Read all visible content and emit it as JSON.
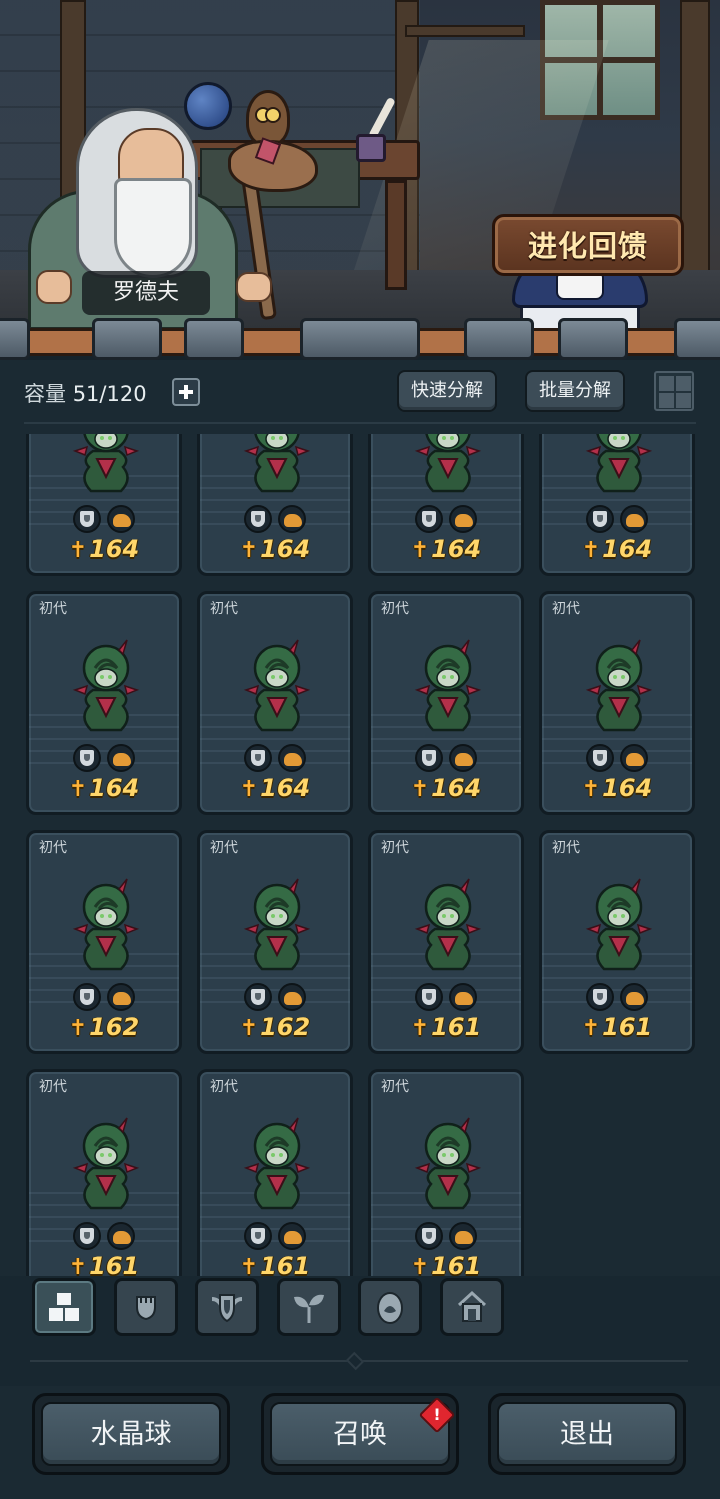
{
  "scene": {
    "npc_name": "罗德夫",
    "evolve_feedback_label": "进化回馈"
  },
  "inventory": {
    "capacity_label": "容量",
    "capacity_value": "51/120",
    "quick_decompose_label": "快速分解",
    "batch_decompose_label": "批量分解"
  },
  "cards": [
    {
      "generation": "",
      "power": "164"
    },
    {
      "generation": "",
      "power": "164"
    },
    {
      "generation": "",
      "power": "164"
    },
    {
      "generation": "",
      "power": "164"
    },
    {
      "generation": "初代",
      "power": "164"
    },
    {
      "generation": "初代",
      "power": "164"
    },
    {
      "generation": "初代",
      "power": "164"
    },
    {
      "generation": "初代",
      "power": "164"
    },
    {
      "generation": "初代",
      "power": "162"
    },
    {
      "generation": "初代",
      "power": "162"
    },
    {
      "generation": "初代",
      "power": "161"
    },
    {
      "generation": "初代",
      "power": "161"
    },
    {
      "generation": "初代",
      "power": "161"
    },
    {
      "generation": "初代",
      "power": "161"
    },
    {
      "generation": "初代",
      "power": "161"
    }
  ],
  "category_tabs": [
    {
      "icon": "all-items-icon",
      "active": true
    },
    {
      "icon": "fist-icon",
      "active": false
    },
    {
      "icon": "winged-shield-icon",
      "active": false
    },
    {
      "icon": "sprout-icon",
      "active": false
    },
    {
      "icon": "egg-icon",
      "active": false
    },
    {
      "icon": "house-icon",
      "active": false
    }
  ],
  "bottom": {
    "crystal_ball_label": "水晶球",
    "summon_label": "召唤",
    "summon_alert": "!",
    "exit_label": "退出"
  },
  "colors": {
    "power_text": "#ffd66a",
    "alert": "#e0262f",
    "card_bg": "#2c3e4b",
    "panel_bg": "#1b2a33"
  }
}
